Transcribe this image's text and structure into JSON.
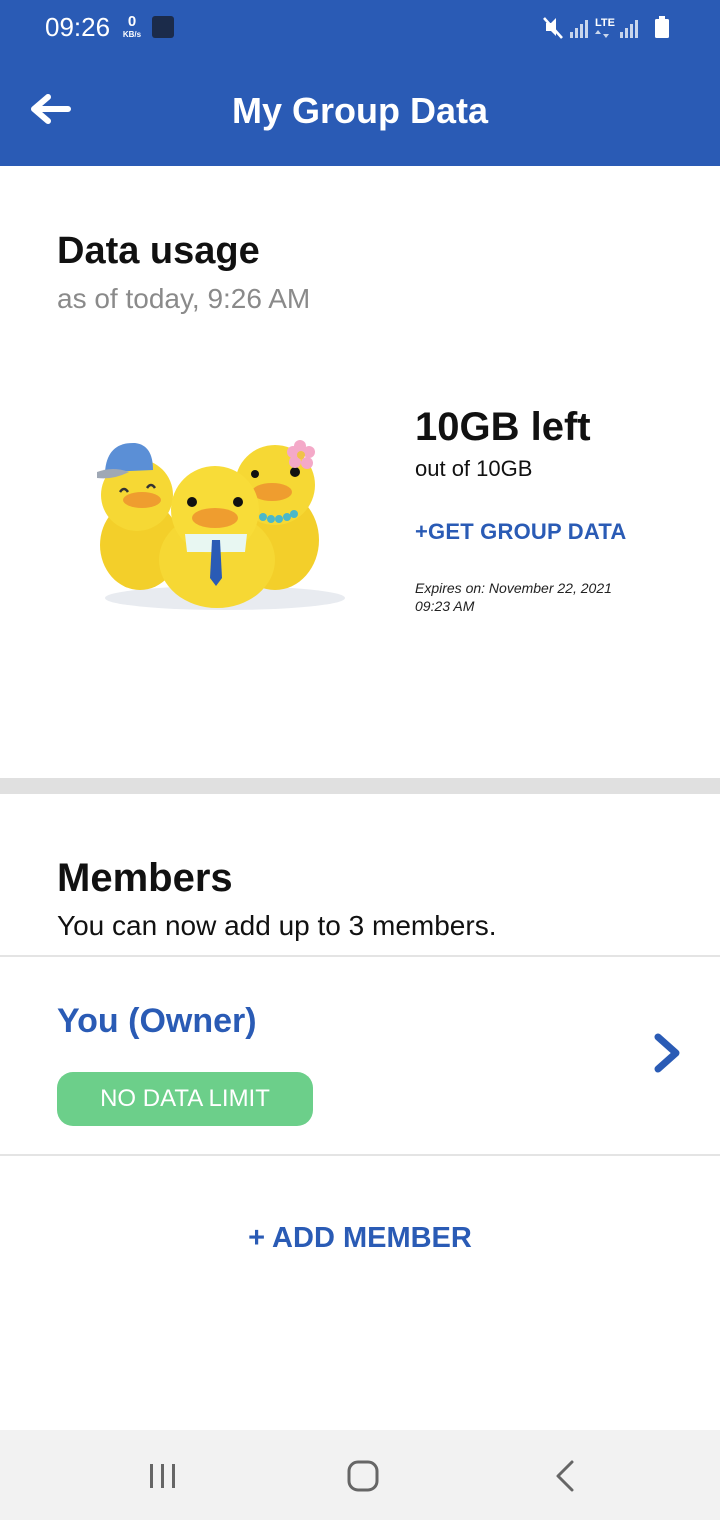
{
  "status_bar": {
    "time": "09:26",
    "net_speed_value": "0",
    "net_speed_unit": "KB/s",
    "network_type": "LTE"
  },
  "header": {
    "title": "My Group Data",
    "back_icon": "arrow-left-icon"
  },
  "usage": {
    "title": "Data usage",
    "as_of": "as of today, 9:26 AM",
    "left": "10GB left",
    "total": "out of 10GB",
    "get_data_link": "+GET GROUP DATA",
    "expires_line1": "Expires on: November 22, 2021",
    "expires_line2": "09:23 AM"
  },
  "members": {
    "title": "Members",
    "subtitle": "You can now add up to 3 members.",
    "list": [
      {
        "name": "You (Owner)",
        "badge": "NO DATA LIMIT"
      }
    ],
    "add_member": "+ ADD MEMBER"
  },
  "colors": {
    "brand_blue": "#2a5bb5",
    "badge_green": "#6ccf8a",
    "divider": "#e0e0e0"
  }
}
